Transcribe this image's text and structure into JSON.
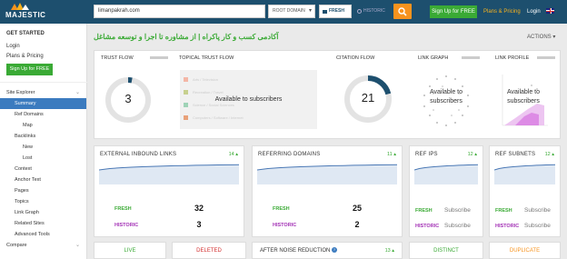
{
  "header": {
    "logo": "MAJESTIC",
    "search_value": "limanpakrah.com",
    "scope_selected": "ROOT DOMAIN",
    "index_fresh": "FRESH",
    "index_historic": "HISTORIC",
    "signup": "Sign Up for FREE",
    "plans": "Plans & Pricing",
    "login": "Login"
  },
  "sidebar": {
    "get_started": "GET STARTED",
    "login": "Login",
    "plans": "Plans & Pricing",
    "signup": "Sign Up for FREE",
    "items": [
      {
        "label": "Site Explorer",
        "active": false
      },
      {
        "label": "Summary",
        "active": true
      },
      {
        "label": "Ref Domains",
        "active": false
      },
      {
        "label": "Map",
        "active": false
      },
      {
        "label": "Backlinks",
        "active": false
      },
      {
        "label": "New",
        "active": false
      },
      {
        "label": "Lost",
        "active": false
      },
      {
        "label": "Context",
        "active": false
      },
      {
        "label": "Anchor Text",
        "active": false
      },
      {
        "label": "Pages",
        "active": false
      },
      {
        "label": "Topics",
        "active": false
      },
      {
        "label": "Link Graph",
        "active": false
      },
      {
        "label": "Related Sites",
        "active": false
      },
      {
        "label": "Advanced Tools",
        "active": false
      },
      {
        "label": "Compare",
        "active": false
      }
    ]
  },
  "page": {
    "title": "آکادمی کسب و کار پاکراه | از مشاوره تا اجرا و توسعه مشاغل",
    "actions": "ACTIONS"
  },
  "overview": {
    "trust_flow_label": "TRUST FLOW",
    "trust_flow_value": "3",
    "trust_flow_fraction": 0.03,
    "topical_label": "TOPICAL TRUST FLOW",
    "topical_rows": [
      "Arts / Television",
      "Recreation / Travel",
      "Science / Social Sciences",
      "Computers / Software / Internet"
    ],
    "topical_row_colors": [
      "#f4b6a6",
      "#c7d08f",
      "#9fd3b7",
      "#e8a17a"
    ],
    "available": "Available to subscribers",
    "citation_flow_label": "CITATION FLOW",
    "citation_flow_value": "21",
    "citation_flow_fraction": 0.21,
    "link_graph_label": "LINK GRAPH",
    "link_graph_available_l1": "Available to",
    "link_graph_available_l2": "subscribers",
    "link_profile_label": "LINK PROFILE",
    "link_profile_available_l1": "Available to",
    "link_profile_available_l2": "subscribers"
  },
  "metrics": [
    {
      "title": "EXTERNAL INBOUND LINKS",
      "count": "14",
      "fresh_label": "FRESH",
      "fresh_value": "32",
      "historic_label": "HISTORIC",
      "historic_value": "3"
    },
    {
      "title": "REFERRING DOMAINS",
      "count": "11",
      "fresh_label": "FRESH",
      "fresh_value": "25",
      "historic_label": "HISTORIC",
      "historic_value": "2"
    },
    {
      "title": "REF IPS",
      "count": "12",
      "fresh_label": "FRESH",
      "fresh_value": "Subscribe",
      "historic_label": "HISTORIC",
      "historic_value": "Subscribe"
    },
    {
      "title": "REF SUBNETS",
      "count": "12",
      "fresh_label": "FRESH",
      "fresh_value": "Subscribe",
      "historic_label": "HISTORIC",
      "historic_value": "Subscribe"
    }
  ],
  "bottom": {
    "live": "LIVE",
    "deleted": "DELETED",
    "noise": "AFTER NOISE REDUCTION",
    "noise_count": "13",
    "distinct": "DISTINCT",
    "duplicate": "DUPLICATE"
  },
  "colors": {
    "brand": "#1d4f6e",
    "accent": "#f7931e",
    "green": "#3aaa35",
    "historic": "#a22fb5",
    "active_nav": "#3b7bbf",
    "spark": "#4a78b5"
  }
}
